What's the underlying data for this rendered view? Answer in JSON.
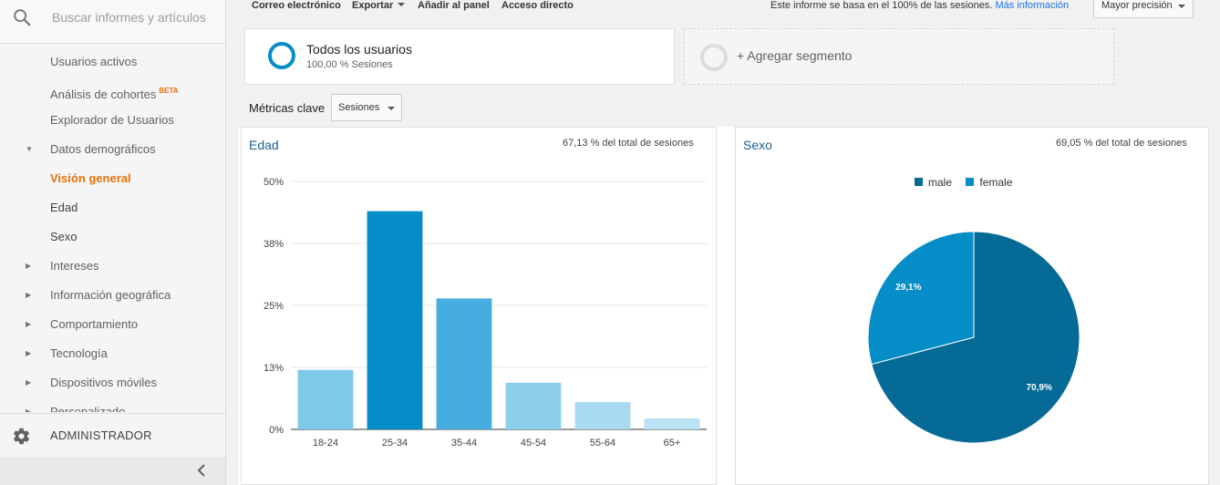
{
  "search": {
    "placeholder": "Buscar informes y artículos"
  },
  "sidebar": {
    "items": [
      {
        "label": "Usuarios activos",
        "badge": ""
      },
      {
        "label": "Análisis de cohortes",
        "badge": "BETA"
      },
      {
        "label": "Explorador de Usuarios",
        "badge": ""
      },
      {
        "label": "Datos demográficos",
        "badge": ""
      },
      {
        "label": "Visión general",
        "badge": ""
      },
      {
        "label": "Edad",
        "badge": ""
      },
      {
        "label": "Sexo",
        "badge": ""
      },
      {
        "label": "Intereses",
        "badge": ""
      },
      {
        "label": "Información geográfica",
        "badge": ""
      },
      {
        "label": "Comportamiento",
        "badge": ""
      },
      {
        "label": "Tecnología",
        "badge": ""
      },
      {
        "label": "Dispositivos móviles",
        "badge": ""
      },
      {
        "label": "Personalizado",
        "badge": ""
      }
    ],
    "admin_label": "ADMINISTRADOR"
  },
  "toolbar": {
    "email": "Correo electrónico",
    "export": "Exportar",
    "add_dashboard": "Añadir al panel",
    "shortcut": "Acceso directo",
    "sampling_note": "Este informe se basa en el 100% de las sesiones.",
    "more_info": "Más información",
    "precision": "Mayor precisión"
  },
  "segments": {
    "all_users": {
      "title": "Todos los usuarios",
      "subtitle": "100,00 % Sesiones"
    },
    "add_label": "+ Agregar segmento"
  },
  "metrics": {
    "label": "Métricas clave",
    "selected": "Sesiones"
  },
  "age_panel": {
    "title": "Edad",
    "pct": "67,13 % del total de sesiones"
  },
  "gender_panel": {
    "title": "Sexo",
    "pct": "69,05 % del total de sesiones"
  },
  "colors": {
    "accent_orange": "#e8710a",
    "link_blue": "#1a73e8",
    "male": "#056a96",
    "female": "#058dc7"
  },
  "chart_data": [
    {
      "type": "bar",
      "categories": [
        "18-24",
        "25-34",
        "35-44",
        "45-54",
        "55-64",
        "65+"
      ],
      "values": [
        12.0,
        44.0,
        26.4,
        9.4,
        5.5,
        2.2
      ],
      "colors": [
        "#7ec8e8",
        "#058dc7",
        "#46aede",
        "#8ccfec",
        "#a8dbf2",
        "#b9e3f5"
      ],
      "yticks": [
        "50%",
        "38%",
        "25%",
        "13%",
        "0%"
      ],
      "ylim": [
        0,
        50
      ],
      "grid": true
    },
    {
      "type": "pie",
      "labels": [
        "male",
        "female"
      ],
      "values": [
        70.9,
        29.1
      ],
      "value_labels": [
        "70,9%",
        "29,1%"
      ],
      "colors": [
        "#056a96",
        "#058dc7"
      ],
      "legend": "top"
    }
  ]
}
